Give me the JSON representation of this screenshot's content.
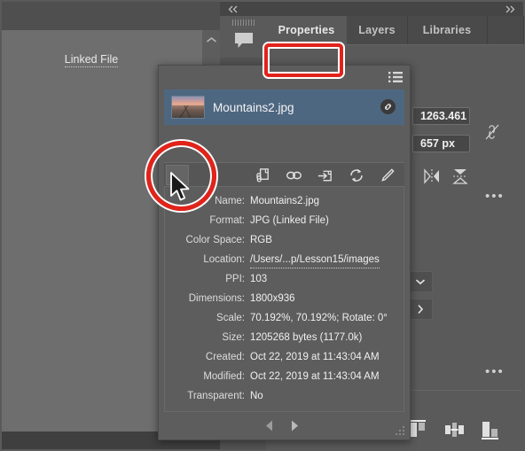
{
  "app": {
    "dock_collapse_left_icon": "chevron-double-left-icon",
    "dock_collapse_right_icon": "chevron-double-right-icon",
    "panel_collapse_icon": "chevron-up-icon",
    "comment_icon": "comment-bubble-icon"
  },
  "tabs": [
    {
      "label": "Properties",
      "active": true
    },
    {
      "label": "Layers",
      "active": false
    },
    {
      "label": "Libraries",
      "active": false
    }
  ],
  "properties_panel": {
    "section_heading": "Linked File",
    "transform": {
      "width_value": "1263.461",
      "height_value": "657 px",
      "constrain_icon": "unlink-chain-icon",
      "flip_horizontal_icon": "flip-horizontal-icon",
      "flip_vertical_icon": "flip-vertical-icon",
      "more_options_icon": "ellipsis-icon"
    },
    "quick_actions": {
      "more_options_icon": "ellipsis-icon",
      "expand_down_icon": "chevron-down-icon",
      "expand_right_icon": "chevron-right-icon"
    },
    "align": [
      {
        "name": "align-top-icon"
      },
      {
        "name": "distribute-horizontal-center-icon"
      },
      {
        "name": "align-bottom-icon"
      }
    ]
  },
  "links_popup": {
    "panel_menu_icon": "panel-menu-icon",
    "selected_link": {
      "thumbnail_icon": "image-thumbnail",
      "file_name": "Mountains2.jpg",
      "status_icon": "linked-chain-badge-icon"
    },
    "toolbar": [
      {
        "name": "relink-from-library-icon"
      },
      {
        "name": "relink-icon"
      },
      {
        "name": "go-to-link-icon"
      },
      {
        "name": "update-link-icon"
      },
      {
        "name": "edit-original-icon"
      }
    ],
    "details": [
      {
        "label": "Name:",
        "value": "Mountains2.jpg",
        "link": false
      },
      {
        "label": "Format:",
        "value": "JPG (Linked File)",
        "link": false
      },
      {
        "label": "Color Space:",
        "value": "RGB",
        "link": false
      },
      {
        "label": "Location:",
        "value": "/Users/...p/Lesson15/images",
        "link": true
      },
      {
        "label": "PPI:",
        "value": "103",
        "link": false
      },
      {
        "label": "Dimensions:",
        "value": "1800x936",
        "link": false
      },
      {
        "label": "Scale:",
        "value": "70.192%, 70.192%; Rotate: 0°",
        "link": false
      },
      {
        "label": "Size:",
        "value": "1205268 bytes (1177.0k)",
        "link": false
      },
      {
        "label": "Created:",
        "value": "Oct 22, 2019 at 11:43:04 AM",
        "link": false
      },
      {
        "label": "Modified:",
        "value": "Oct 22, 2019 at 11:43:04 AM",
        "link": false
      },
      {
        "label": "Transparent:",
        "value": "No",
        "link": false
      }
    ],
    "footer": {
      "prev_icon": "triangle-left-icon",
      "next_icon": "triangle-right-icon",
      "resize_grip_icon": "resize-grip-icon"
    }
  },
  "annotations": {
    "color": "#e2231a",
    "highlight_rect_target": "Linked File",
    "highlight_circle_target": "show-link-info-button",
    "cursor_icon": "arrow-cursor"
  }
}
